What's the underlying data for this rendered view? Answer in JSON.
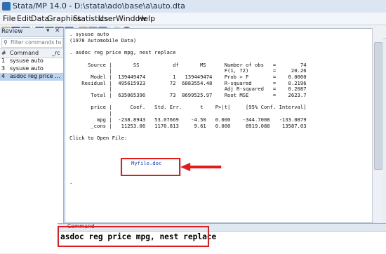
{
  "window": {
    "title": "Stata/MP 14.0 - D:\\stata\\ado\\base\\a\\auto.dta"
  },
  "menu": [
    "File",
    "Edit",
    "Data",
    "Graphics",
    "Statistics",
    "User",
    "Window",
    "Help"
  ],
  "review": {
    "title": "Review",
    "filter_placeholder": "Filter commands he",
    "col_hash": "#",
    "col_command": "Command",
    "col_rc": "_rc",
    "items": [
      {
        "n": "1",
        "cmd": "sysuse auto"
      },
      {
        "n": "3",
        "cmd": "sysuse auto"
      },
      {
        "n": "4",
        "cmd": "asdoc reg price ..."
      }
    ],
    "selected_index": 2
  },
  "results": {
    "text": ". sysuse auto\n(1978 Automobile Data)\n\n. asdoc reg price mpg, nest replace\n\n      Source |       SS           df       MS      Number of obs   =        74\n             |                                     F(1, 72)        =     20.26\n       Model |  139449474         1   139449474    Prob > F        =    0.0000\n    Residual |  495615923        72  6883554.48    R-squared       =    0.2196\n             |                                     Adj R-squared   =    0.2087\n       Total |  635065396        73  8699525.97    Root MSE        =    2623.7\n\n       price |      Coef.   Std. Err.      t    P>|t|     [95% Conf. Interval]\n             |\n         mpg |  -238.8943   53.07669    -4.50   0.000    -344.7008   -133.0879\n       _cons |   11253.06   1170.813     9.61   0.000     8919.088    13587.03\n\nClick to Open File:",
    "link": "Myfile.doc",
    "trailing": "."
  },
  "command_panel": {
    "title": "Command",
    "text": "asdoc reg price mpg, nest replace"
  },
  "colors": {
    "annotation_red": "#e21b1b",
    "link_blue": "#1a3fcc",
    "selection": "#bcd3ef"
  }
}
